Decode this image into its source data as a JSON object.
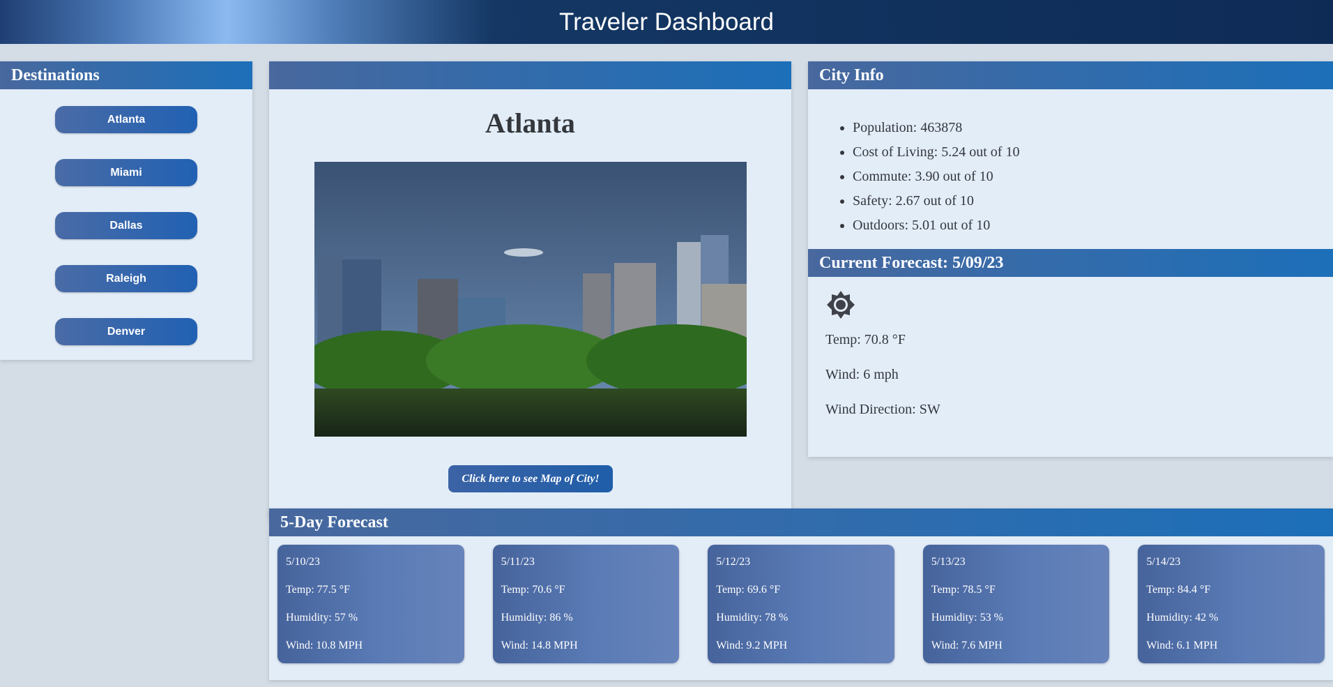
{
  "header": {
    "title": "Traveler Dashboard"
  },
  "destinations": {
    "title": "Destinations",
    "items": [
      "Atlanta",
      "Miami",
      "Dallas",
      "Raleigh",
      "Denver"
    ]
  },
  "city": {
    "name": "Atlanta",
    "map_button": "Click here to see Map of City!"
  },
  "city_info": {
    "title": "City Info",
    "items": [
      "Population: 463878",
      "Cost of Living: 5.24 out of 10",
      "Commute: 3.90 out of 10",
      "Safety: 2.67 out of 10",
      "Outdoors: 5.01 out of 10"
    ]
  },
  "current_forecast": {
    "title": "Current Forecast: 5/09/23",
    "icon": "sun-icon",
    "temp": "Temp: 70.8 °F",
    "wind": "Wind: 6 mph",
    "wind_direction": "Wind Direction: SW"
  },
  "five_day": {
    "title": "5-Day Forecast",
    "days": [
      {
        "date": "5/10/23",
        "temp": "Temp: 77.5 °F",
        "humidity": "Humidity: 57 %",
        "wind": "Wind: 10.8 MPH"
      },
      {
        "date": "5/11/23",
        "temp": "Temp: 70.6 °F",
        "humidity": "Humidity: 86 %",
        "wind": "Wind: 14.8 MPH"
      },
      {
        "date": "5/12/23",
        "temp": "Temp: 69.6 °F",
        "humidity": "Humidity: 78 %",
        "wind": "Wind: 9.2 MPH"
      },
      {
        "date": "5/13/23",
        "temp": "Temp: 78.5 °F",
        "humidity": "Humidity: 53 %",
        "wind": "Wind: 7.6 MPH"
      },
      {
        "date": "5/14/23",
        "temp": "Temp: 84.4 °F",
        "humidity": "Humidity: 42 %",
        "wind": "Wind: 6.1 MPH"
      }
    ]
  }
}
